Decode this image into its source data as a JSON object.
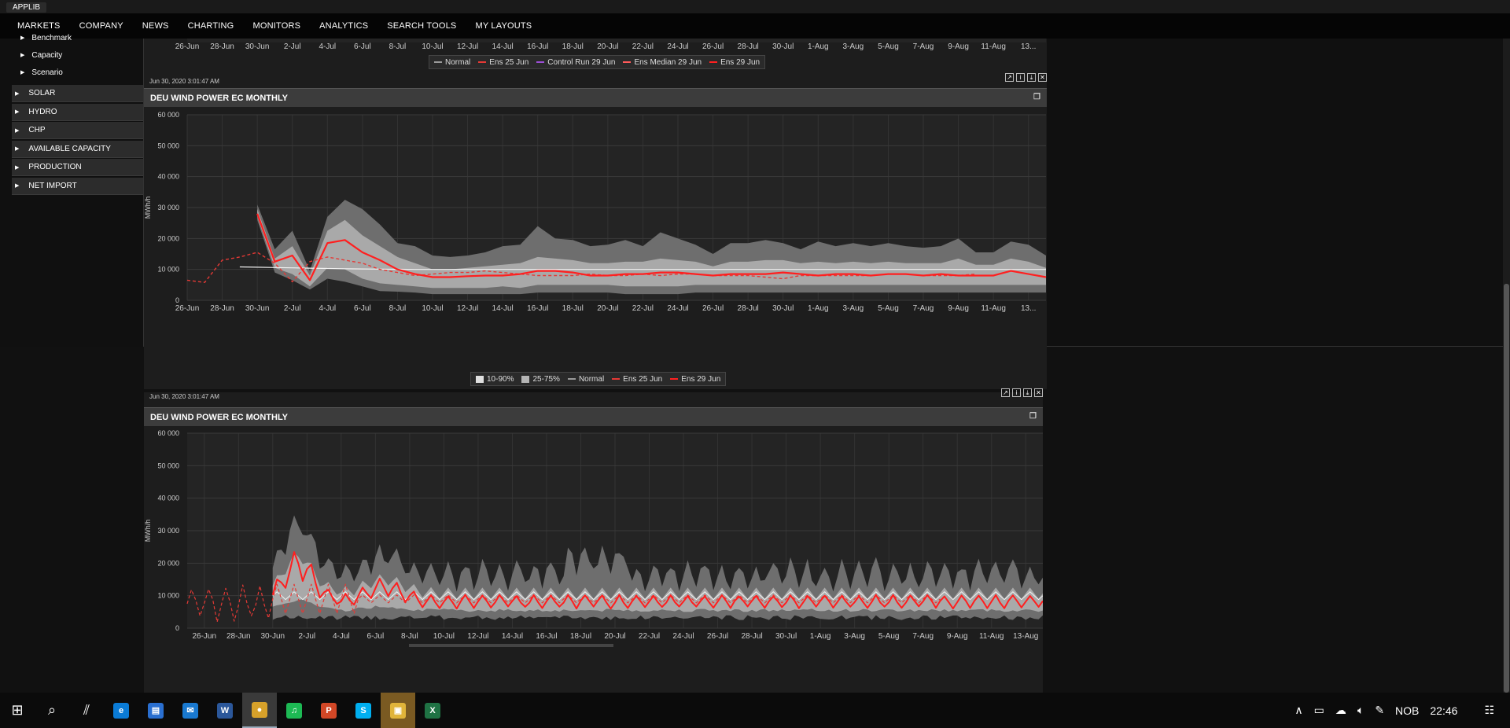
{
  "app": {
    "title": "APPLIB"
  },
  "nav": [
    "MARKETS",
    "COMPANY",
    "NEWS",
    "CHARTING",
    "MONITORS",
    "ANALYTICS",
    "SEARCH TOOLS",
    "MY LAYOUTS"
  ],
  "sidebar": {
    "sub_items": [
      "Benchmark",
      "Capacity",
      "Scenario"
    ],
    "items": [
      "SOLAR",
      "HYDRO",
      "CHP",
      "AVAILABLE CAPACITY",
      "PRODUCTION",
      "NET IMPORT"
    ]
  },
  "axis": {
    "x_ticks": [
      "26-Jun",
      "28-Jun",
      "30-Jun",
      "2-Jul",
      "4-Jul",
      "6-Jul",
      "8-Jul",
      "10-Jul",
      "12-Jul",
      "14-Jul",
      "16-Jul",
      "18-Jul",
      "20-Jul",
      "22-Jul",
      "24-Jul",
      "26-Jul",
      "28-Jul",
      "30-Jul",
      "1-Aug",
      "3-Aug",
      "5-Aug",
      "7-Aug",
      "9-Aug",
      "11-Aug",
      "13..."
    ],
    "x_ticks_p3": [
      "26-Jun",
      "28-Jun",
      "30-Jun",
      "2-Jul",
      "4-Jul",
      "6-Jul",
      "8-Jul",
      "10-Jul",
      "12-Jul",
      "14-Jul",
      "16-Jul",
      "18-Jul",
      "20-Jul",
      "22-Jul",
      "24-Jul",
      "26-Jul",
      "28-Jul",
      "30-Jul",
      "1-Aug",
      "3-Aug",
      "5-Aug",
      "7-Aug",
      "9-Aug",
      "11-Aug",
      "13-Aug"
    ],
    "y_ticks": [
      "0",
      "10 000",
      "20 000",
      "30 000",
      "40 000",
      "50 000",
      "60 000"
    ],
    "ylabel": "MWh/h"
  },
  "panel1": {
    "legend": [
      "Normal",
      "Ens 25 Jun",
      "Control Run 29 Jun",
      "Ens Median 29 Jun",
      "Ens 29 Jun"
    ],
    "legend_colors": [
      "#9a9a9a",
      "#e53935",
      "#9c4fd6",
      "#ff5a5a",
      "#ff2020"
    ]
  },
  "panel2": {
    "timestamp": "Jun 30, 2020 3:01:47 AM",
    "title": "DEU WIND POWER EC MONTHLY",
    "legend": [
      "10-90%",
      "25-75%",
      "Normal",
      "Ens 25 Jun",
      "Ens 29 Jun"
    ]
  },
  "panel3": {
    "timestamp": "Jun 30, 2020 3:01:47 AM",
    "title": "DEU WIND POWER EC MONTHLY"
  },
  "tools": [
    "share-icon",
    "info-icon",
    "download-icon",
    "close-icon"
  ],
  "taskbar": {
    "lang": "NOB",
    "time": "22:46",
    "apps": [
      "start-icon",
      "search-icon",
      "task-view-icon",
      "edge-icon",
      "store-icon",
      "mail-icon",
      "word-icon",
      "chrome-icon",
      "spotify-icon",
      "powerpoint-icon",
      "skype-icon",
      "file-explorer-icon",
      "excel-icon"
    ]
  },
  "chart_data": [
    {
      "type": "area",
      "title": "DEU WIND POWER EC MONTHLY",
      "ylabel": "MWh/h",
      "ylim": [
        0,
        60000
      ],
      "xrange": [
        "2020-06-26",
        "2020-08-14"
      ],
      "x": [
        "2020-06-26",
        "2020-06-27",
        "2020-06-28",
        "2020-06-29",
        "2020-06-30",
        "2020-07-01",
        "2020-07-02",
        "2020-07-03",
        "2020-07-04",
        "2020-07-05",
        "2020-07-06",
        "2020-07-07",
        "2020-07-08",
        "2020-07-09",
        "2020-07-10",
        "2020-07-11",
        "2020-07-12",
        "2020-07-13",
        "2020-07-14",
        "2020-07-15",
        "2020-07-16",
        "2020-07-17",
        "2020-07-18",
        "2020-07-19",
        "2020-07-20",
        "2020-07-21",
        "2020-07-22",
        "2020-07-23",
        "2020-07-24",
        "2020-07-25",
        "2020-07-26",
        "2020-07-27",
        "2020-07-28",
        "2020-07-29",
        "2020-07-30",
        "2020-07-31",
        "2020-08-01",
        "2020-08-02",
        "2020-08-03",
        "2020-08-04",
        "2020-08-05",
        "2020-08-06",
        "2020-08-07",
        "2020-08-08",
        "2020-08-09",
        "2020-08-10",
        "2020-08-11",
        "2020-08-12",
        "2020-08-13",
        "2020-08-14"
      ],
      "series": [
        {
          "name": "Ens 25 Jun",
          "style": "dashed",
          "values": [
            6500,
            5800,
            13000,
            14000,
            15500,
            12000,
            6000,
            12500,
            14000,
            13000,
            12000,
            10000,
            9000,
            8000,
            8500,
            9000,
            9000,
            9500,
            9000,
            8500,
            8000,
            8000,
            8000,
            8500,
            8000,
            8000,
            8500,
            8000,
            8500,
            8500,
            8000,
            8000,
            8000,
            7500,
            7000,
            8000,
            8000,
            8000,
            8000,
            8000,
            8500,
            8500,
            8000,
            8000,
            8000,
            8500,
            null,
            null,
            null,
            null
          ]
        },
        {
          "name": "Ens 29 Jun",
          "values": [
            null,
            null,
            null,
            null,
            28000,
            12500,
            14500,
            6500,
            18500,
            19500,
            15500,
            13000,
            10000,
            8500,
            7500,
            7500,
            7800,
            8000,
            8000,
            8500,
            9500,
            9500,
            9000,
            8000,
            8000,
            8500,
            8500,
            9000,
            9000,
            8500,
            8000,
            8500,
            8500,
            8500,
            9000,
            8500,
            8000,
            8500,
            8500,
            8000,
            8500,
            8500,
            8000,
            8500,
            8000,
            8000,
            8000,
            9500,
            8500,
            7500
          ]
        },
        {
          "name": "Normal",
          "values": [
            null,
            null,
            null,
            10800,
            10700,
            10600,
            10500,
            10400,
            10300,
            10200,
            10150,
            10100,
            10050,
            10000,
            10000,
            10000,
            10000,
            10000,
            10000,
            10000,
            10000,
            10000,
            10000,
            10000,
            10000,
            10000,
            10000,
            10000,
            10000,
            10000,
            10000,
            10000,
            10000,
            10000,
            10000,
            10000,
            10000,
            10000,
            10000,
            10000,
            10000,
            10000,
            10000,
            10000,
            10000,
            10000,
            10000,
            10000,
            10000,
            10000
          ]
        },
        {
          "name": "10-90%",
          "low": [
            null,
            null,
            null,
            null,
            26000,
            9000,
            6500,
            3500,
            7000,
            6000,
            4500,
            3000,
            2800,
            2500,
            2000,
            2000,
            2000,
            2000,
            2000,
            2000,
            2500,
            2500,
            2500,
            2500,
            2500,
            2000,
            2000,
            2000,
            2000,
            2500,
            2500,
            2500,
            2500,
            2500,
            2500,
            2500,
            2500,
            2500,
            2500,
            2500,
            2500,
            2500,
            2500,
            2500,
            2500,
            2500,
            2500,
            2500,
            2500,
            2500
          ],
          "high": [
            null,
            null,
            null,
            null,
            31000,
            16500,
            22500,
            9500,
            27000,
            32500,
            29500,
            24500,
            18500,
            17500,
            14500,
            14000,
            14500,
            15500,
            17500,
            18000,
            24000,
            20000,
            19500,
            17500,
            18000,
            19500,
            17500,
            22000,
            20000,
            18000,
            15000,
            18500,
            18500,
            19500,
            18500,
            16500,
            19000,
            17500,
            18500,
            17500,
            18500,
            17500,
            17000,
            17500,
            20000,
            15500,
            15500,
            19000,
            18000,
            14500
          ]
        },
        {
          "name": "25-75%",
          "low": [
            null,
            null,
            null,
            null,
            27000,
            10500,
            8500,
            4500,
            10500,
            10000,
            7000,
            5500,
            5000,
            4500,
            4000,
            4000,
            4000,
            4000,
            4500,
            4000,
            5000,
            5000,
            5000,
            5000,
            5000,
            4500,
            4500,
            4500,
            4500,
            5000,
            5000,
            5000,
            5000,
            5000,
            5000,
            5000,
            5000,
            5000,
            5000,
            5000,
            5000,
            5000,
            5000,
            5000,
            5000,
            5000,
            5000,
            5000,
            5000,
            5000
          ],
          "high": [
            null,
            null,
            null,
            null,
            29500,
            13500,
            17500,
            8000,
            22500,
            26000,
            21000,
            17500,
            14000,
            12000,
            10000,
            10000,
            10500,
            11000,
            11500,
            12000,
            14000,
            13500,
            13000,
            12000,
            12000,
            12500,
            12500,
            13500,
            13000,
            12500,
            11000,
            12500,
            12500,
            13000,
            13000,
            12000,
            12500,
            12000,
            12500,
            12000,
            12500,
            12000,
            12000,
            12000,
            13500,
            11500,
            11500,
            13500,
            12500,
            10500
          ]
        }
      ]
    },
    {
      "type": "area",
      "title": "DEU WIND POWER EC MONTHLY",
      "ylabel": "MWh/h",
      "ylim": [
        0,
        60000
      ],
      "xrange": [
        "2020-06-25",
        "2020-08-14"
      ],
      "series": [
        {
          "name": "Ens 25 Jun",
          "style": "dashed"
        },
        {
          "name": "Ens 29 Jun"
        },
        {
          "name": "Normal"
        },
        {
          "name": "10-90%"
        },
        {
          "name": "25-75%"
        }
      ]
    }
  ]
}
